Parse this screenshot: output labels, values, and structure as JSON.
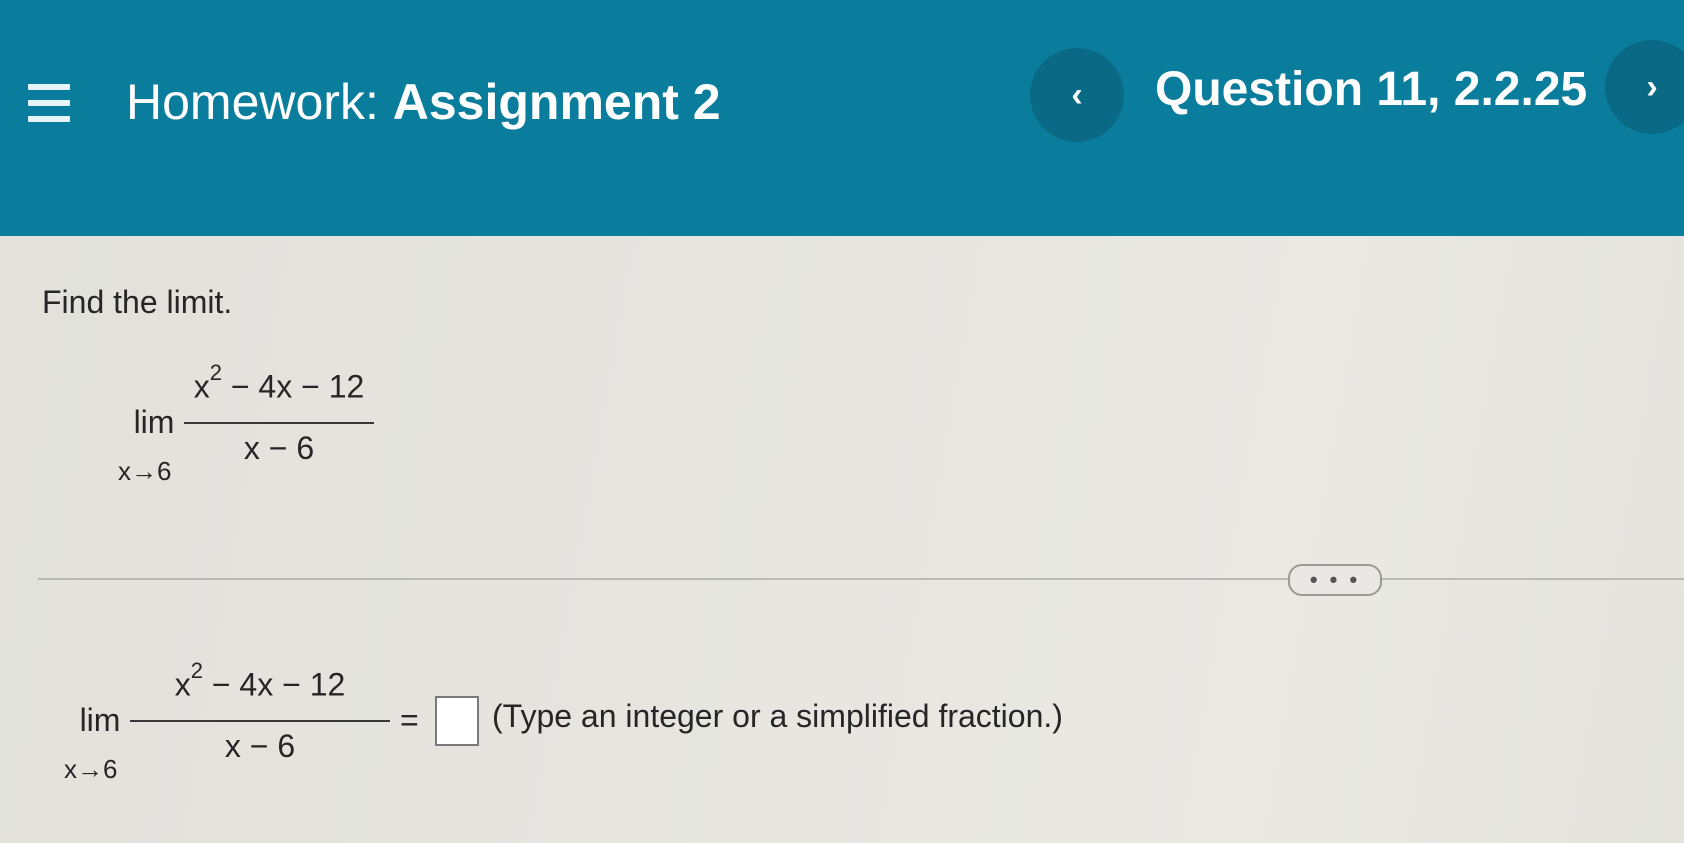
{
  "header": {
    "title_prefix": "Homework:",
    "title_name": "Assignment 2",
    "prev_label": "‹",
    "question_label": "Question 11, 2.2.25",
    "next_label": "›"
  },
  "question": {
    "instruction": "Find the limit.",
    "limit": {
      "lim": "lim",
      "approach": "x→6",
      "numerator_base": "x",
      "numerator_exp": "2",
      "numerator_rest": " − 4x − 12",
      "denominator": "x − 6"
    },
    "more_label": "• • •"
  },
  "answer": {
    "equals": "=",
    "hint": "(Type an integer or a simplified fraction.)"
  },
  "colors": {
    "header_bg": "#0b7d9c",
    "nav_button_bg": "#0a6a86",
    "content_bg": "#e4e3de"
  },
  "icons": [
    "menu-icon",
    "chevron-left-icon",
    "chevron-right-icon"
  ]
}
